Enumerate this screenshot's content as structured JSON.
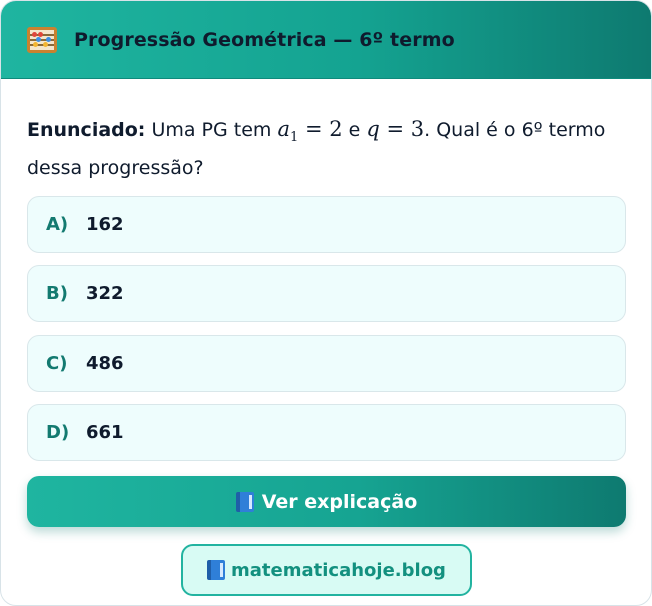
{
  "header": {
    "icon": "abacus-icon",
    "title": "Progressão Geométrica — 6º termo"
  },
  "question": {
    "lead": "Enunciado:",
    "text_1": " Uma PG tem ",
    "a_var": "a",
    "a_sub": "1",
    "a_eq": " = 2",
    "text_2": " e ",
    "q_var": "q",
    "q_eq": " = 3",
    "text_3": ". Qual é o 6º termo dessa progressão?"
  },
  "options": [
    {
      "letter": "A)",
      "value": "162"
    },
    {
      "letter": "B)",
      "value": "322"
    },
    {
      "letter": "C)",
      "value": "486"
    },
    {
      "letter": "D)",
      "value": "661"
    }
  ],
  "explain_button": {
    "icon": "book-icon",
    "label": "Ver explicação"
  },
  "blog_link": {
    "icon": "book-icon",
    "label": "matematicahoje.blog"
  },
  "colors": {
    "accent": "#1fb5a0",
    "accent_dark": "#0e7a70",
    "option_bg": "#eefdfd",
    "letter": "#137a70"
  }
}
